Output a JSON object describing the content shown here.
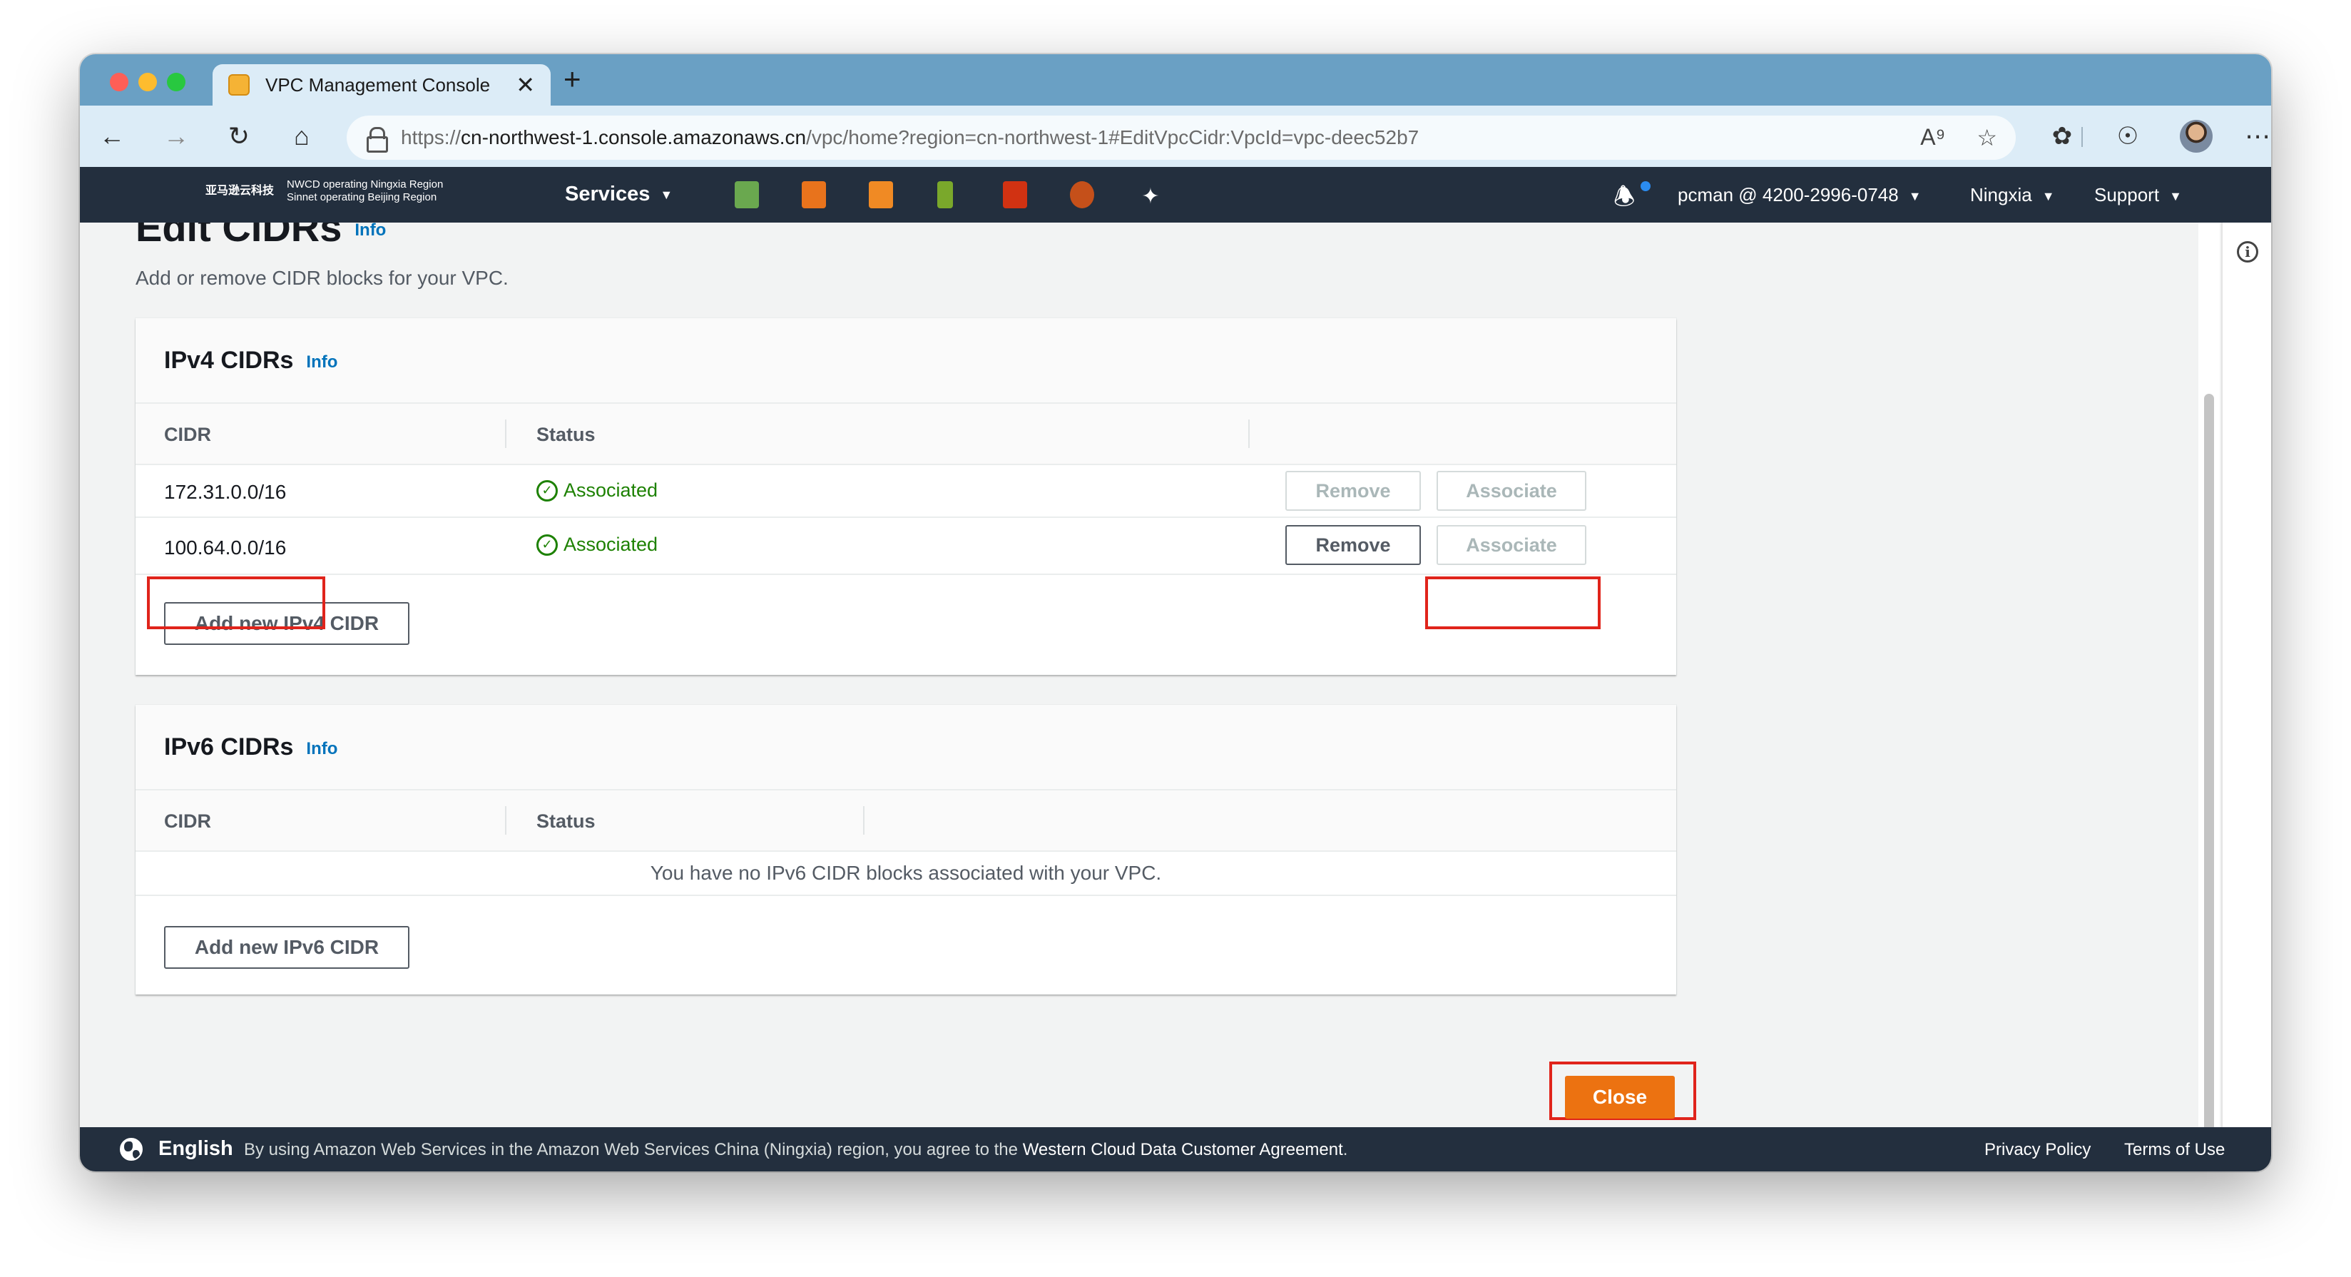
{
  "browser": {
    "tab_title": "VPC Management Console",
    "tab_close": "✕",
    "new_tab": "+",
    "url_scheme": "https://",
    "url_host": "cn-northwest-1.console.amazonaws.cn",
    "url_path": "/vpc/home?region=cn-northwest-1#EditVpcCidr:VpcId=vpc-deec52b7"
  },
  "aws_header": {
    "logo_mark": "亚马逊云科技",
    "logo_line1": "NWCD operating Ningxia Region",
    "logo_line2": "Sinnet operating Beijing Region",
    "services_label": "Services",
    "account": "pcman @ 4200-2996-0748",
    "region": "Ningxia",
    "support": "Support",
    "service_icon_colors": [
      "#6aa84f",
      "#e8731c",
      "#f08a24",
      "#7aa82b",
      "#d13212",
      "#c5501a"
    ]
  },
  "page": {
    "title": "Edit CIDRs",
    "title_info": "Info",
    "description": "Add or remove CIDR blocks for your VPC."
  },
  "ipv4": {
    "title": "IPv4 CIDRs",
    "info": "Info",
    "col_cidr": "CIDR",
    "col_status": "Status",
    "rows": [
      {
        "cidr": "172.31.0.0/16",
        "status": "Associated",
        "remove": "Remove",
        "associate": "Associate"
      },
      {
        "cidr": "100.64.0.0/16",
        "status": "Associated",
        "remove": "Remove",
        "associate": "Associate"
      }
    ],
    "add_button": "Add new IPv4 CIDR"
  },
  "ipv6": {
    "title": "IPv6 CIDRs",
    "info": "Info",
    "col_cidr": "CIDR",
    "col_status": "Status",
    "empty_message": "You have no IPv6 CIDR blocks associated with your VPC.",
    "add_button": "Add new IPv6 CIDR"
  },
  "actions": {
    "close": "Close"
  },
  "footer": {
    "language": "English",
    "notice_prefix": "By using Amazon Web Services in the Amazon Web Services China (Ningxia) region, you agree to the",
    "agreement_link": "Western Cloud Data Customer Agreement",
    "notice_suffix": ".",
    "privacy": "Privacy Policy",
    "terms": "Terms of Use"
  },
  "colors": {
    "primary": "#ec7211",
    "link": "#0073bb",
    "success": "#1d8102",
    "highlight": "#e0241b",
    "header_bg": "#232f3e"
  }
}
